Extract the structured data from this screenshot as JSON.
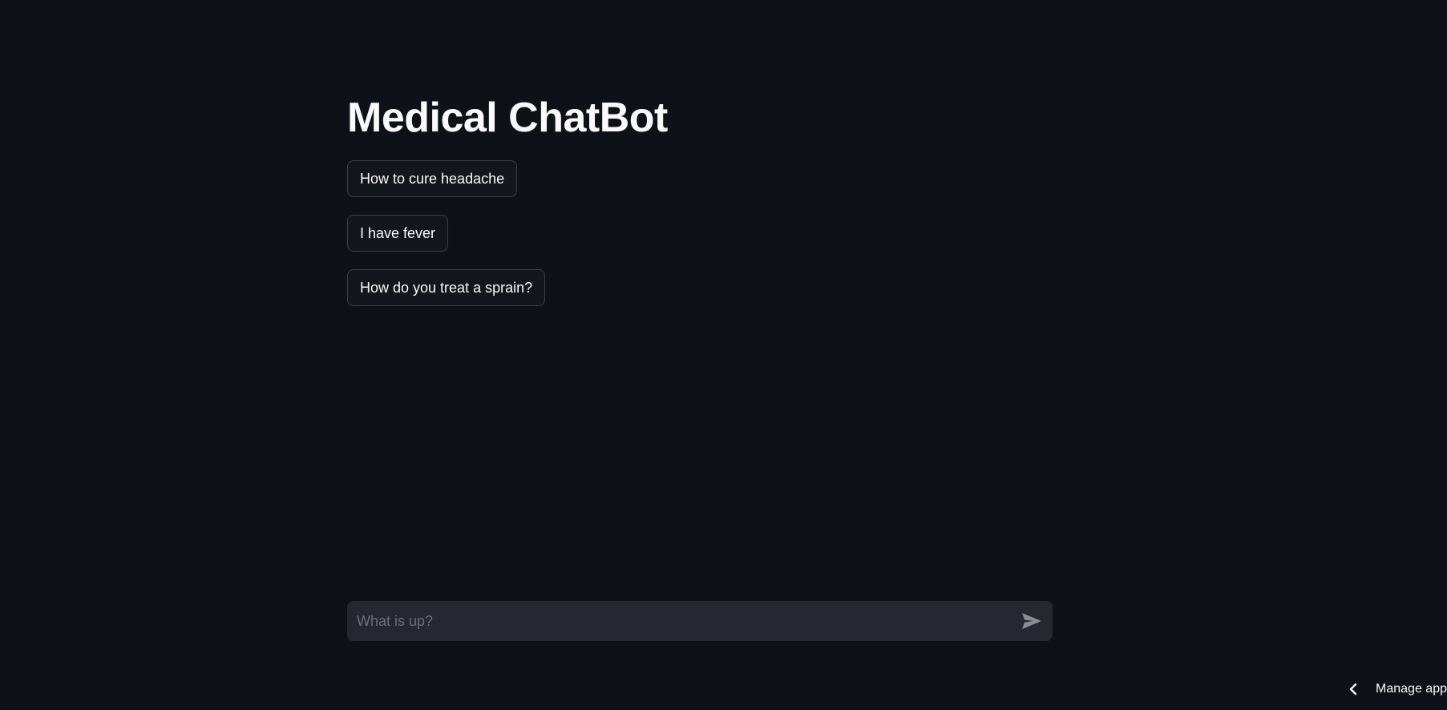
{
  "page": {
    "title": "Medical ChatBot"
  },
  "suggestions": [
    {
      "label": "How to cure headache"
    },
    {
      "label": "I have fever"
    },
    {
      "label": "How do you treat a sprain?"
    }
  ],
  "chat_input": {
    "placeholder": "What is up?",
    "value": "",
    "send_icon": "send-icon"
  },
  "footer": {
    "manage_label": "Manage app",
    "chevron_icon": "chevron-left-icon"
  },
  "colors": {
    "background": "#0e1117",
    "text": "#fafafa",
    "button_border": "#3d404b",
    "input_background": "#262730",
    "placeholder": "#6c6f78"
  }
}
